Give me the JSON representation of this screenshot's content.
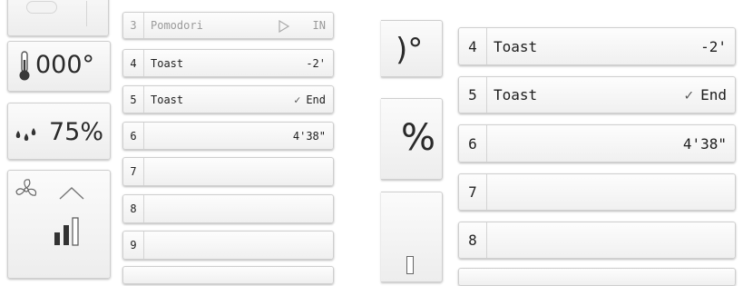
{
  "left_panel": {
    "temperature": {
      "value": "000",
      "unit": "°",
      "icon": "thermometer-icon"
    },
    "humidity": {
      "value": "75",
      "unit": "%",
      "icon": "droplets-icon"
    },
    "fan": {
      "icon": "fan-icon",
      "arrow_icon": "chevron-up-icon",
      "level_icon": "signal-bars-icon",
      "level": 0.67
    }
  },
  "program_list": {
    "rows": [
      {
        "number": "3",
        "name": "Pomodori",
        "value": "IN",
        "icon": "play-outline-icon",
        "faded": true
      },
      {
        "number": "4",
        "name": "Toast",
        "value": "-2'"
      },
      {
        "number": "5",
        "name": "Toast",
        "value": "End",
        "icon": "checkmark-icon"
      },
      {
        "number": "6",
        "name": "",
        "value": "4'38\""
      },
      {
        "number": "7",
        "name": "",
        "value": ""
      },
      {
        "number": "8",
        "name": "",
        "value": ""
      },
      {
        "number": "9",
        "name": "",
        "value": ""
      }
    ]
  },
  "zoom_view": {
    "partial_degree": ")°",
    "partial_percent": "%",
    "rows": [
      {
        "number": "4",
        "name": "Toast",
        "value": "-2'"
      },
      {
        "number": "5",
        "name": "Toast",
        "value": "End",
        "icon": "checkmark-icon"
      },
      {
        "number": "6",
        "name": "",
        "value": "4'38\""
      },
      {
        "number": "7",
        "name": "",
        "value": ""
      },
      {
        "number": "8",
        "name": "",
        "value": ""
      }
    ]
  }
}
